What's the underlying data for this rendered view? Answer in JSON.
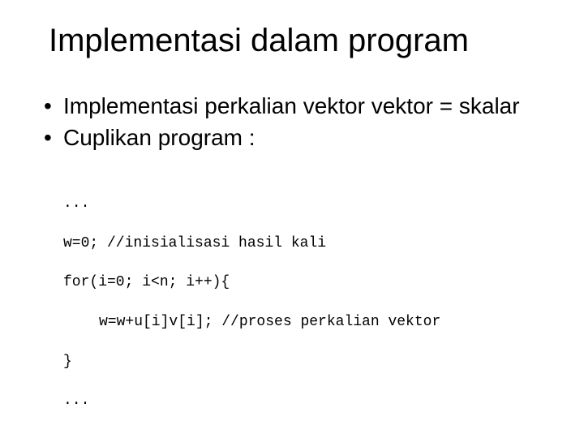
{
  "title": "Implementasi dalam program",
  "bullets": [
    "Implementasi perkalian vektor vektor = skalar",
    "Cuplikan program :"
  ],
  "code": {
    "l1": "...",
    "l2": "w=0; //inisialisasi hasil kali",
    "l3": "for(i=0; i<n; i++){",
    "l4": "w=w+u[i]v[i]; //proses perkalian vektor",
    "l5": "}",
    "l6": "..."
  }
}
